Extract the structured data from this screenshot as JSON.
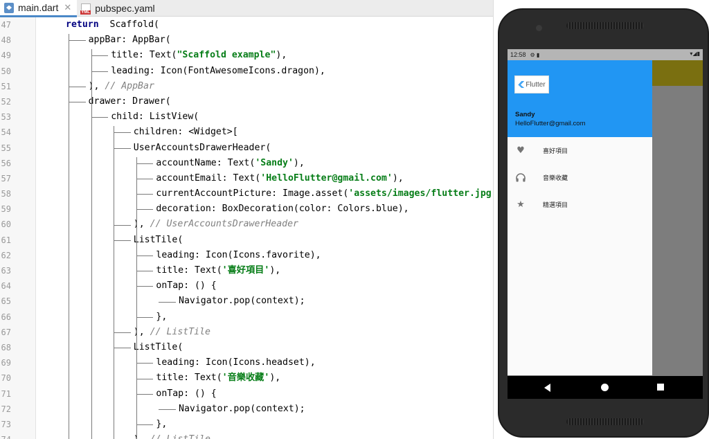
{
  "tabs": [
    {
      "label": "main.dart",
      "icon": "dart-file-icon"
    },
    {
      "label": "pubspec.yaml",
      "icon": "yaml-file-icon"
    }
  ],
  "editor": {
    "lines": [
      {
        "n": "47",
        "indent": 0,
        "code": [
          [
            "kw",
            "return"
          ],
          [
            "",
            "  Scaffold("
          ]
        ]
      },
      {
        "n": "48",
        "indent": 1,
        "code": [
          [
            "",
            "appBar: AppBar("
          ]
        ]
      },
      {
        "n": "49",
        "indent": 2,
        "code": [
          [
            "",
            "title: Text("
          ],
          [
            "str",
            "\"Scaffold example\""
          ],
          [
            "",
            "),"
          ]
        ]
      },
      {
        "n": "50",
        "indent": 2,
        "code": [
          [
            "",
            "leading: Icon(FontAwesomeIcons.dragon),"
          ]
        ]
      },
      {
        "n": "51",
        "indent": 1,
        "code": [
          [
            "",
            "), "
          ],
          [
            "cmt",
            "// AppBar"
          ]
        ]
      },
      {
        "n": "52",
        "indent": 1,
        "code": [
          [
            "",
            "drawer: Drawer("
          ]
        ]
      },
      {
        "n": "53",
        "indent": 2,
        "code": [
          [
            "",
            "child: ListView("
          ]
        ]
      },
      {
        "n": "54",
        "indent": 3,
        "code": [
          [
            "",
            "children: <Widget>["
          ]
        ]
      },
      {
        "n": "55",
        "indent": 3,
        "code": [
          [
            "",
            "UserAccountsDrawerHeader("
          ]
        ]
      },
      {
        "n": "56",
        "indent": 4,
        "code": [
          [
            "",
            "accountName: Text("
          ],
          [
            "str",
            "'Sandy'"
          ],
          [
            "",
            "),"
          ]
        ]
      },
      {
        "n": "57",
        "indent": 4,
        "code": [
          [
            "",
            "accountEmail: Text("
          ],
          [
            "str",
            "'HelloFlutter@gmail.com'"
          ],
          [
            "",
            "),"
          ]
        ]
      },
      {
        "n": "58",
        "indent": 4,
        "code": [
          [
            "",
            "currentAccountPicture: Image.asset("
          ],
          [
            "str",
            "'assets/images/flutter.jpg'"
          ],
          [
            "",
            "),"
          ]
        ]
      },
      {
        "n": "59",
        "indent": 4,
        "code": [
          [
            "",
            "decoration: BoxDecoration(color: Colors.blue),"
          ]
        ]
      },
      {
        "n": "60",
        "indent": 3,
        "code": [
          [
            "",
            "), "
          ],
          [
            "cmt",
            "// UserAccountsDrawerHeader"
          ]
        ]
      },
      {
        "n": "61",
        "indent": 3,
        "code": [
          [
            "",
            "ListTile("
          ]
        ]
      },
      {
        "n": "62",
        "indent": 4,
        "code": [
          [
            "",
            "leading: Icon(Icons.favorite),"
          ]
        ]
      },
      {
        "n": "63",
        "indent": 4,
        "code": [
          [
            "",
            "title: Text("
          ],
          [
            "str",
            "'喜好項目'"
          ],
          [
            "",
            "),"
          ]
        ]
      },
      {
        "n": "64",
        "indent": 4,
        "code": [
          [
            "",
            "onTap: () {"
          ]
        ]
      },
      {
        "n": "65",
        "indent": 5,
        "code": [
          [
            "",
            "Navigator.pop(context);"
          ]
        ]
      },
      {
        "n": "66",
        "indent": 4,
        "code": [
          [
            "",
            "},"
          ]
        ]
      },
      {
        "n": "67",
        "indent": 3,
        "code": [
          [
            "",
            "), "
          ],
          [
            "cmt",
            "// ListTile"
          ]
        ]
      },
      {
        "n": "68",
        "indent": 3,
        "code": [
          [
            "",
            "ListTile("
          ]
        ]
      },
      {
        "n": "69",
        "indent": 4,
        "code": [
          [
            "",
            "leading: Icon(Icons.headset),"
          ]
        ]
      },
      {
        "n": "70",
        "indent": 4,
        "code": [
          [
            "",
            "title: Text("
          ],
          [
            "str",
            "'音樂收藏'"
          ],
          [
            "",
            "),"
          ]
        ]
      },
      {
        "n": "71",
        "indent": 4,
        "code": [
          [
            "",
            "onTap: () {"
          ]
        ]
      },
      {
        "n": "72",
        "indent": 5,
        "code": [
          [
            "",
            "Navigator.pop(context);"
          ]
        ]
      },
      {
        "n": "73",
        "indent": 4,
        "code": [
          [
            "",
            "},"
          ]
        ]
      },
      {
        "n": "74",
        "indent": 3,
        "code": [
          [
            "",
            "), "
          ],
          [
            "cmt",
            "// ListTile"
          ]
        ]
      }
    ]
  },
  "device": {
    "status_time": "12:58",
    "status_icons": "⚙ ▮",
    "status_right": "▾◢▮",
    "account_picture_text": "Flutter",
    "account_name": "Sandy",
    "account_email": "HelloFlutter@gmail.com",
    "tiles": [
      {
        "label": "喜好項目",
        "icon": "favorite-icon"
      },
      {
        "label": "音樂收藏",
        "icon": "headset-icon"
      },
      {
        "label": "精選項目",
        "icon": "star-icon"
      }
    ],
    "header_color": "#2196f3",
    "appbar_color": "#7a6f10"
  }
}
